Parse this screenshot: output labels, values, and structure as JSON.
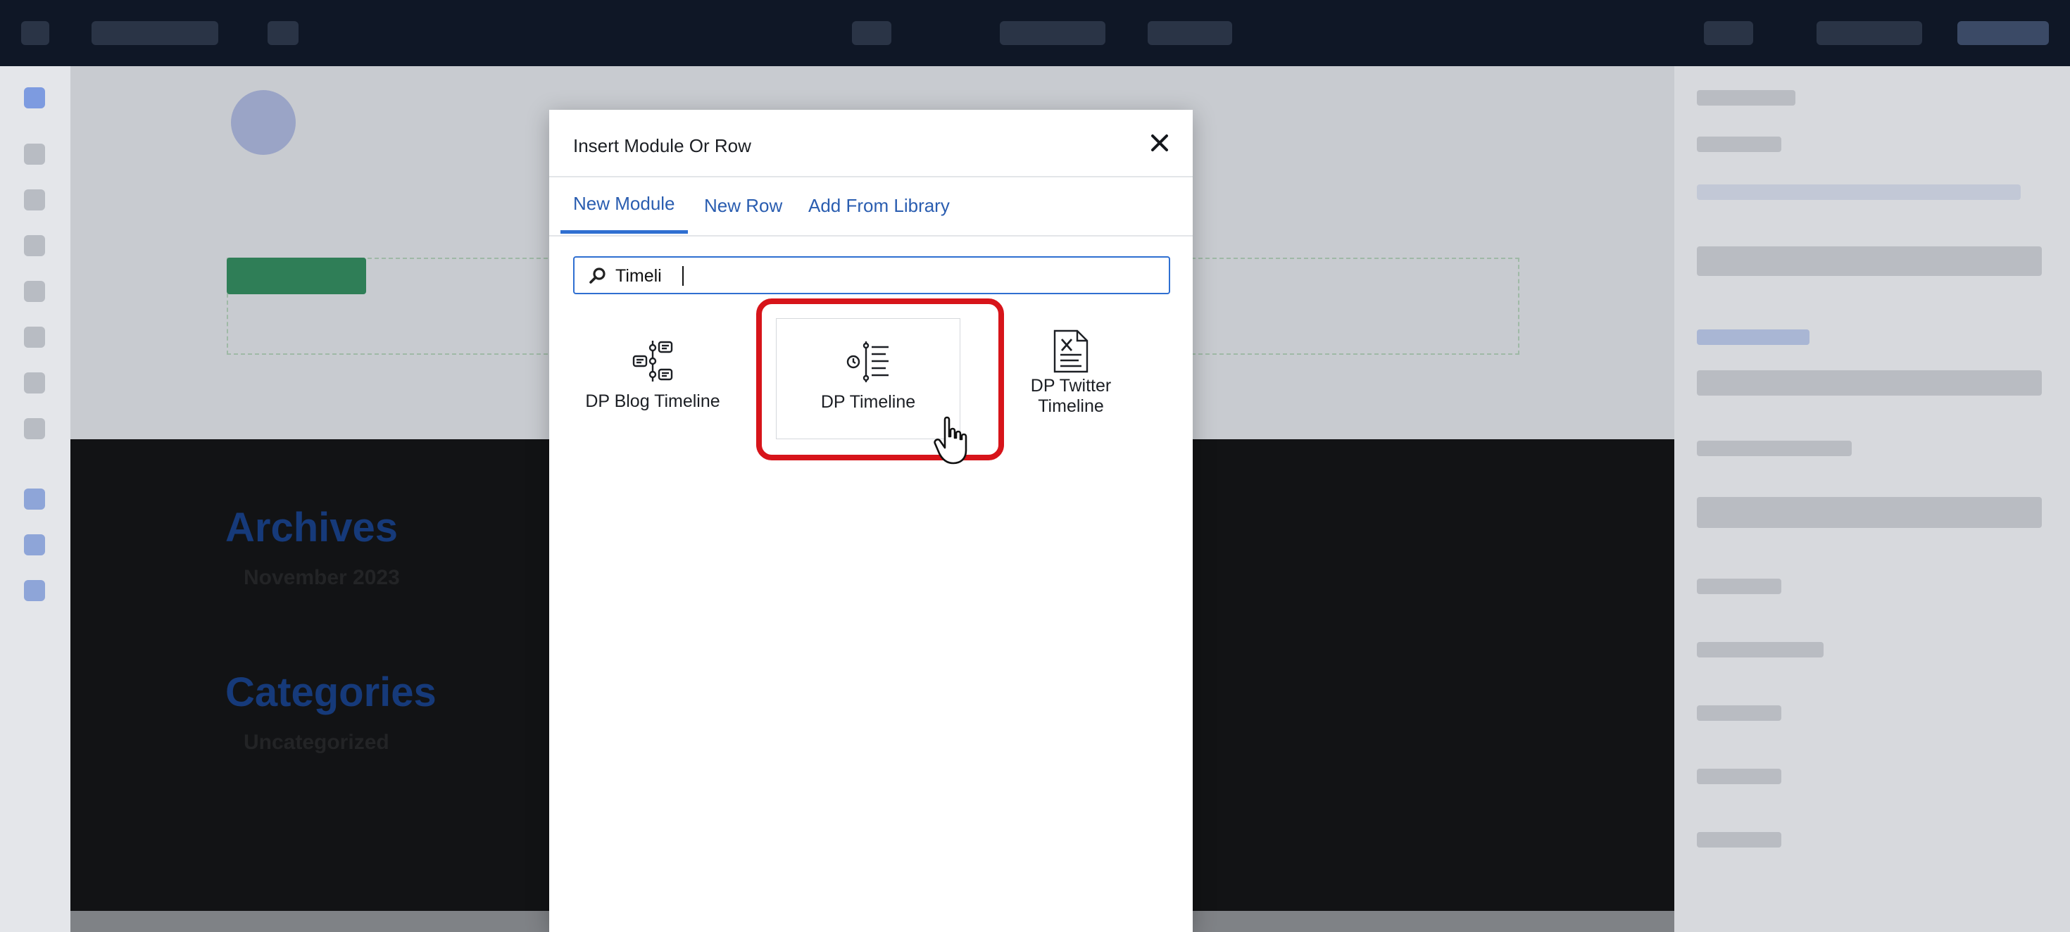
{
  "dialog": {
    "title": "Insert Module Or Row",
    "close_symbol": "✕"
  },
  "tabs": [
    {
      "label": "New Module",
      "active": true
    },
    {
      "label": "New Row",
      "active": false
    },
    {
      "label": "Add From Library",
      "active": false
    }
  ],
  "search": {
    "value": "Timeli",
    "icon": "search-icon"
  },
  "modules": [
    {
      "label": "DP Blog Timeline",
      "icon": "blog-timeline-icon"
    },
    {
      "label": "DP Timeline",
      "icon": "timeline-icon",
      "highlighted": true
    },
    {
      "label": "DP Twitter\nTimeline",
      "icon": "twitter-timeline-icon"
    }
  ],
  "background": {
    "heading_1": "Archives",
    "line_1": "November 2023",
    "heading_2": "Categories",
    "line_2": "Uncategorized"
  },
  "colors": {
    "accent": "#2f6fd1",
    "highlight": "#d7141a"
  }
}
